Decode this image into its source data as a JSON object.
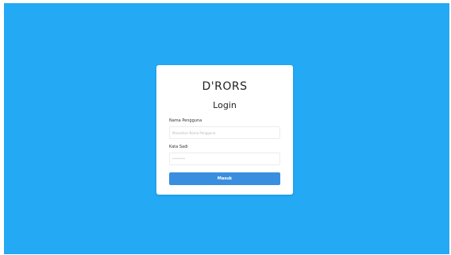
{
  "brand": "D'RORS",
  "form": {
    "title": "Login",
    "username_label": "Nama Pengguna",
    "username_placeholder": "Masukkan Nama Pengguna",
    "password_label": "Kata Sadi",
    "password_placeholder": "********",
    "submit_label": "Masuk"
  },
  "colors": {
    "background": "#24a9f5",
    "button": "#3a8ee0",
    "card": "#ffffff"
  }
}
